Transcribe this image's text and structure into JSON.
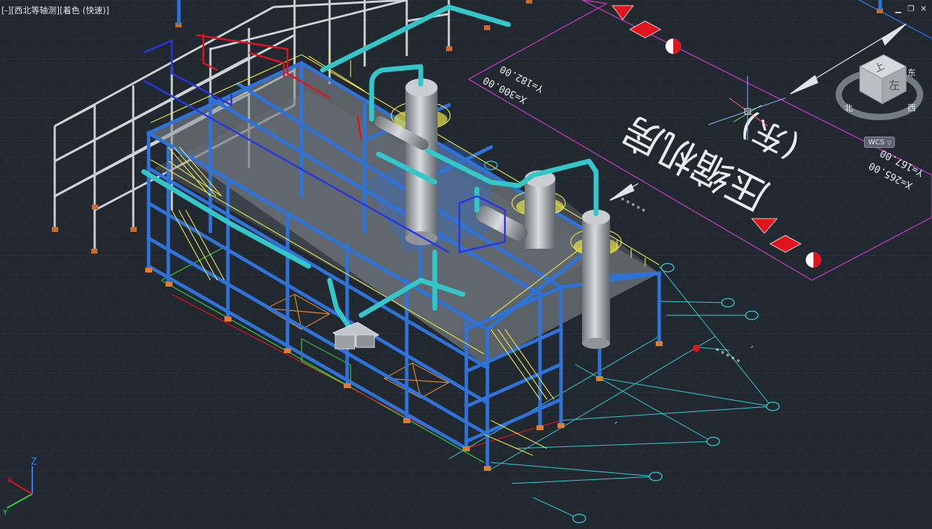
{
  "viewport": {
    "control": "[-]",
    "view_name": "[西北等轴测]",
    "visual_style": "[着色 (快速)]"
  },
  "window_controls": {
    "minimize": "▁",
    "restore": "❐",
    "close": "✕"
  },
  "viewcube": {
    "top_face": "上",
    "left_face": "左",
    "compass_n": "北",
    "compass_w": "西",
    "compass_e": "东"
  },
  "wcs": {
    "label": "WCS"
  },
  "ucs": {
    "z_label": "Z",
    "x_label": "X",
    "y_label": "Y"
  },
  "site_block": {
    "title": "压缩机房",
    "subtitle": "(东)",
    "coord_top_x": "X=300.00",
    "coord_top_y": "Y=182.00",
    "coord_right_x": "X=265.00",
    "coord_right_y": "Y=167.00"
  },
  "colors": {
    "background": "#212830",
    "steel_blue": "#2f73d8",
    "pipe_cyan": "#35c6c9",
    "rail_yellow": "#e8e24a",
    "frame_grey": "#cfd2d6",
    "vessel_grey": "#a9acb0",
    "marker_red": "#e0141c",
    "boundary_magenta": "#b83ab8",
    "dim_cyan": "#36d0d8"
  }
}
